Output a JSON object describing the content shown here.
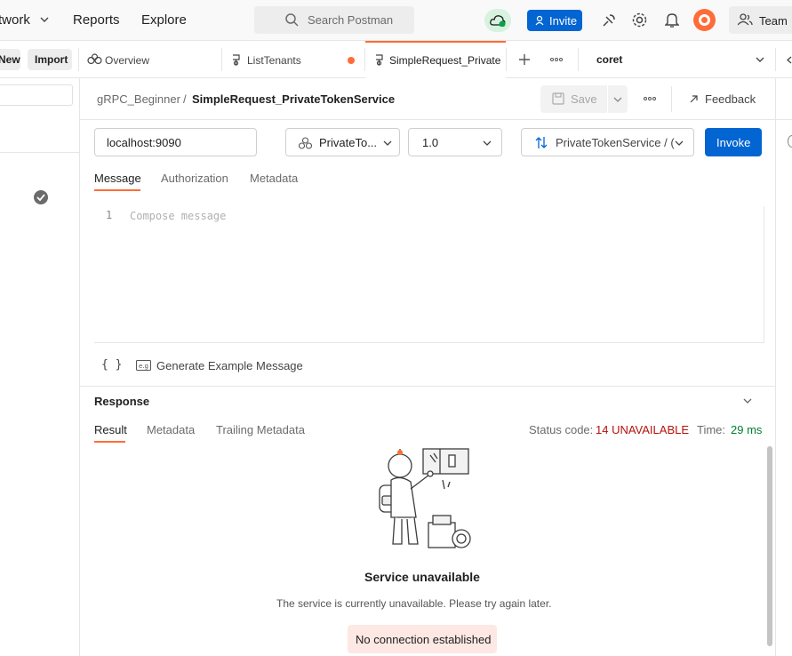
{
  "topbar": {
    "nav": [
      "twork",
      "Reports",
      "Explore"
    ],
    "search_placeholder": "Search Postman",
    "invite_label": "Invite",
    "team_label": "Team"
  },
  "tabs": {
    "left_buttons": [
      "New",
      "Import"
    ],
    "items": [
      {
        "label": "Overview"
      },
      {
        "label": "ListTenants"
      },
      {
        "label": "SimpleRequest_Private"
      }
    ],
    "environment": "coret"
  },
  "breadcrumb": {
    "collection": "gRPC_Beginner",
    "separator": "/",
    "request": "SimpleRequest_PrivateTokenService",
    "save_label": "Save",
    "feedback_label": "Feedback"
  },
  "request": {
    "url": "localhost:9090",
    "service": "PrivateTo...",
    "version": "1.0",
    "method": "PrivateTokenService / (",
    "invoke_label": "Invoke"
  },
  "request_tabs": [
    "Message",
    "Authorization",
    "Metadata"
  ],
  "editor": {
    "line_number": "1",
    "placeholder": "Compose message"
  },
  "editor_footer": {
    "braces": "{ }",
    "generate_label": "Generate Example Message"
  },
  "response": {
    "title": "Response",
    "tabs": [
      "Result",
      "Metadata",
      "Trailing Metadata"
    ],
    "status_label": "Status code:",
    "status_value": "14 UNAVAILABLE",
    "time_label": "Time:",
    "time_value": "29 ms",
    "empty_title": "Service unavailable",
    "empty_desc": "The service is currently unavailable. Please try again later.",
    "no_connection": "No connection established"
  },
  "colors": {
    "accent": "#ff6c37",
    "primary": "#0265d2",
    "error": "#b5120b",
    "success": "#007f31"
  }
}
